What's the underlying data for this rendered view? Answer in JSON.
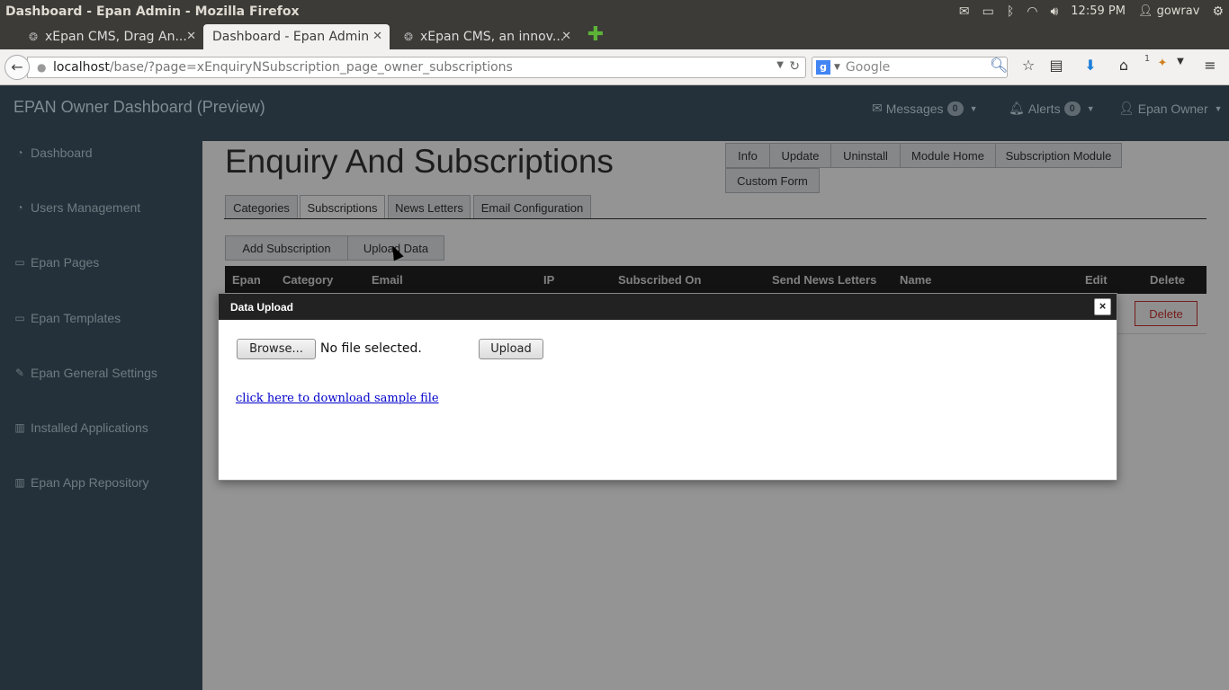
{
  "os": {
    "window_title": "Dashboard - Epan Admin - Mozilla Firefox",
    "time": "12:59 PM",
    "user": "gowrav"
  },
  "browser": {
    "tabs": [
      {
        "label": "xEpan CMS, Drag An..."
      },
      {
        "label": "Dashboard - Epan Admin"
      },
      {
        "label": "xEpan CMS, an innov..."
      }
    ],
    "url_host": "localhost",
    "url_path": "/base/?page=xEnquiryNSubscription_page_owner_subscriptions",
    "search_placeholder": "Google",
    "badge_count": "1"
  },
  "header": {
    "brand": "EPAN Owner Dashboard (Preview)",
    "messages_label": "Messages",
    "messages_count": "0",
    "alerts_label": "Alerts",
    "alerts_count": "0",
    "user_label": "Epan Owner"
  },
  "sidebar": {
    "items": [
      {
        "label": "Dashboard"
      },
      {
        "label": "Users Management"
      },
      {
        "label": "Epan Pages"
      },
      {
        "label": "Epan Templates"
      },
      {
        "label": "Epan General Settings"
      },
      {
        "label": "Installed Applications"
      },
      {
        "label": "Epan App Repository"
      }
    ]
  },
  "main": {
    "title": "Enquiry And Subscriptions",
    "module_buttons": [
      "Info",
      "Update",
      "Uninstall",
      "Module Home",
      "Subscription Module",
      "Custom Form"
    ],
    "tabs": [
      "Categories",
      "Subscriptions",
      "News Letters",
      "Email Configuration"
    ],
    "actions": [
      "Add Subscription",
      "Upload Data"
    ],
    "table_headers": [
      "Epan",
      "Category",
      "Email",
      "IP",
      "Subscribed On",
      "Send News Letters",
      "Name",
      "Edit",
      "Delete"
    ],
    "row_delete_label": "Delete"
  },
  "dialog": {
    "title": "Data Upload",
    "close": "×",
    "browse_label": "Browse...",
    "no_file_text": "No file selected.",
    "upload_label": "Upload",
    "sample_link": "click here to download sample file"
  }
}
